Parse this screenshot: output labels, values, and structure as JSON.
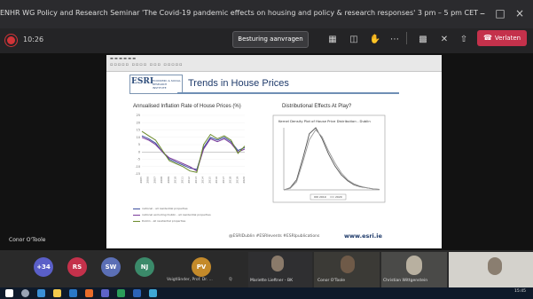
{
  "window": {
    "title": "ENHR WG Policy and Research Seminar 'The Covid-19 pandemic effects on housing and policy & research responses' 3 pm – 5 pm CET",
    "minimize": "–",
    "maximize": "□",
    "close": "×"
  },
  "toolbar": {
    "elapsed": "10:26",
    "request_control": "Besturing aanvragen",
    "leave": "Verlaten",
    "leave_color": "#c4314b"
  },
  "slide": {
    "logo_mark": "ESRI",
    "logo_text": "ECONOMIC & SOCIAL RESEARCH INSTITUTE",
    "title": "Trends in House Prices",
    "chart_left_heading": "Annualised Inflation Rate of House Prices (%)",
    "chart_right_heading": "Distributional Effects At Play?",
    "footer_tags": "@ESRIDublin   #ESRIevents   #ESRIpublications",
    "website": "www.esri.ie"
  },
  "chart_data": [
    {
      "type": "line",
      "title": "Annualised Inflation Rate of House Prices (%)",
      "ylim": [
        -15,
        25
      ],
      "yticks": [
        25,
        20,
        15,
        10,
        5,
        0,
        -5,
        -10,
        -15
      ],
      "x": [
        2005,
        2006,
        2007,
        2008,
        2009,
        2010,
        2011,
        2012,
        2013,
        2014,
        2015,
        2016,
        2017,
        2018,
        2019,
        2020
      ],
      "series": [
        {
          "name": "national - all residential properties",
          "color": "#3d4fa0",
          "values": [
            11,
            9,
            6,
            0,
            -5,
            -7,
            -9,
            -11,
            -12,
            3,
            10,
            8,
            10,
            7,
            1,
            3
          ]
        },
        {
          "name": "national excluding Dublin - all residential properties",
          "color": "#7a3a9a",
          "values": [
            10,
            8,
            5,
            0,
            -4,
            -6,
            -8,
            -10,
            -13,
            2,
            9,
            7,
            9,
            6,
            0,
            2
          ]
        },
        {
          "name": "Dublin - all residential properties",
          "color": "#6a8a2a",
          "values": [
            14,
            11,
            8,
            1,
            -6,
            -8,
            -10,
            -13,
            -14,
            5,
            12,
            9,
            11,
            8,
            -1,
            4
          ]
        }
      ]
    },
    {
      "type": "line",
      "title": "Kernel Density Plot of House Price Distribution - Dublin",
      "series": [
        {
          "name": "2019",
          "color": "#555555",
          "values": [
            0,
            0.2,
            1.0,
            3.2,
            5.6,
            6.2,
            5.1,
            3.6,
            2.4,
            1.5,
            0.9,
            0.5,
            0.3,
            0.2,
            0.1,
            0.05
          ]
        },
        {
          "name": "2020",
          "color": "#999999",
          "values": [
            0,
            0.15,
            0.8,
            2.8,
            5.0,
            6.0,
            5.3,
            3.9,
            2.7,
            1.7,
            1.0,
            0.6,
            0.35,
            0.2,
            0.1,
            0.05
          ]
        }
      ]
    }
  ],
  "presenter": "Conor O'Toole",
  "participants": {
    "overflow": "+34",
    "initials": [
      {
        "text": "RS",
        "color": "#c4314b"
      },
      {
        "text": "SW",
        "color": "#5b6fb5"
      },
      {
        "text": "NJ",
        "color": "#3b8a6a"
      },
      {
        "text": "PV",
        "color": "#c48a2a"
      }
    ],
    "pv_name": "Voigtländer, Prof. Dr. ...",
    "video": [
      {
        "name": "Mariette Lieftner - BK"
      },
      {
        "name": "Conor O'Toole"
      },
      {
        "name": "Christian Wittgenstein"
      }
    ]
  },
  "taskbar": {
    "clock": "15:45"
  }
}
